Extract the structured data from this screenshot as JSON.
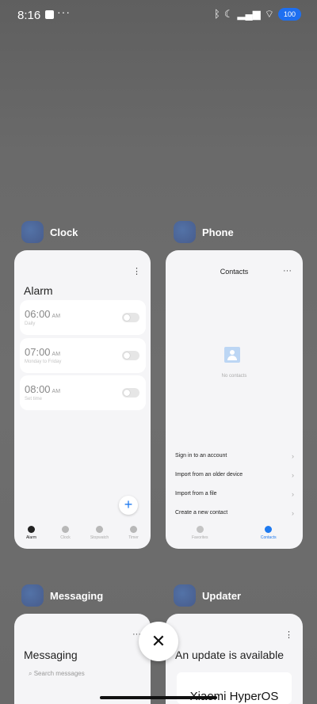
{
  "status_bar": {
    "time": "8:16",
    "notification_dots": "···",
    "battery": "100"
  },
  "recent_apps": [
    {
      "name": "Clock",
      "card": {
        "menu": "⋮",
        "title": "Alarm",
        "alarms": [
          {
            "time": "06:00",
            "ampm": "AM",
            "label": "Daily",
            "enabled": false
          },
          {
            "time": "07:00",
            "ampm": "AM",
            "label": "Monday to Friday",
            "enabled": false
          },
          {
            "time": "08:00",
            "ampm": "AM",
            "label": "Set time",
            "enabled": false
          }
        ],
        "fab": "+",
        "nav": [
          "Alarm",
          "Clock",
          "Stopwatch",
          "Timer"
        ],
        "active_nav": "Alarm"
      }
    },
    {
      "name": "Phone",
      "card": {
        "title": "Contacts",
        "menu": "···",
        "empty_text": "No contacts",
        "actions": [
          "Sign in to an account",
          "Import from an older device",
          "Import from a file",
          "Create a new contact"
        ],
        "nav": [
          "Favorites",
          "Contacts"
        ],
        "active_nav": "Contacts"
      }
    },
    {
      "name": "Messaging",
      "card": {
        "title": "Messaging",
        "menu": "···",
        "search_placeholder": "Search messages"
      }
    },
    {
      "name": "Updater",
      "card": {
        "menu": "⋮",
        "title": "An update is available",
        "banner": "Xiaomi HyperOS"
      }
    }
  ],
  "close_button": "✕",
  "colors": {
    "accent": "#1e7af0",
    "battery": "#1e6ff0",
    "background": "#6a6a6a"
  }
}
